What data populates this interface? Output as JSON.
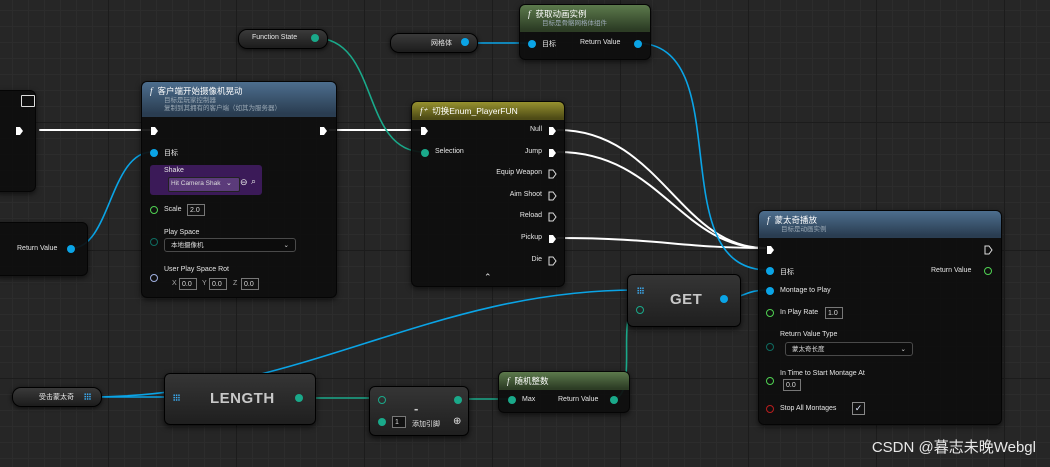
{
  "nodes": {
    "function_state": {
      "label": "Function State"
    },
    "mesh_var": {
      "label": "网格体"
    },
    "get_anim_instance": {
      "title": "获取动画实例",
      "subtitle": "目标是骨骼网格体组件",
      "in_target": "目标",
      "out_return": "Return Value"
    },
    "client_shake": {
      "title": "客户端开始摄像机晃动",
      "subtitle_1": "目标是玩家控制器",
      "subtitle_2": "复制到其拥有的客户端（如其为服务器）",
      "in_target": "目标",
      "shake_label": "Shake",
      "shake_value": "Hit Camera Shak",
      "scale_label": "Scale",
      "scale_value": "2.0",
      "play_space_label": "Play Space",
      "play_space_value": "本地摄像机",
      "rot_label": "User Play Space Rot",
      "rot_x_label": "X",
      "rot_x": "0.0",
      "rot_y_label": "Y",
      "rot_y": "0.0",
      "rot_z_label": "Z",
      "rot_z": "0.0"
    },
    "left_return": {
      "label": "Return Value"
    },
    "switch_enum": {
      "title": "切换Enum_PlayerFUN",
      "selection": "Selection",
      "outputs": [
        "Null",
        "Jump",
        "Equip Weapon",
        "Aim Shoot",
        "Reload",
        "Pickup",
        "Die"
      ]
    },
    "montage_play": {
      "title": "蒙太奇播放",
      "subtitle": "目标是动画实例",
      "in_target": "目标",
      "out_return": "Return Value",
      "montage": "Montage to Play",
      "rate_label": "In Play Rate",
      "rate_value": "1.0",
      "rvt_label": "Return Value Type",
      "rvt_value": "蒙太奇长度",
      "time_label": "In Time to Start Montage At",
      "time_value": "0.0",
      "stop_label": "Stop All Montages"
    },
    "hit_montage_var": {
      "label": "受击蒙太奇"
    },
    "length": {
      "label": "LENGTH"
    },
    "get": {
      "label": "GET"
    },
    "subtract": {
      "symbol": "-",
      "value": "1",
      "add_pin": "添加引脚"
    },
    "random_int": {
      "title": "随机整数",
      "max": "Max",
      "out_return": "Return Value"
    }
  },
  "colors": {
    "object_pin": "#0aa4e6",
    "int_pin": "#1aa98a",
    "exec_wire": "#ffffff"
  },
  "icons": {
    "function": "f-function-icon",
    "monitor": "monitor-icon",
    "array": "array-grid-icon"
  },
  "watermark": "CSDN @暮志未晚Webgl"
}
